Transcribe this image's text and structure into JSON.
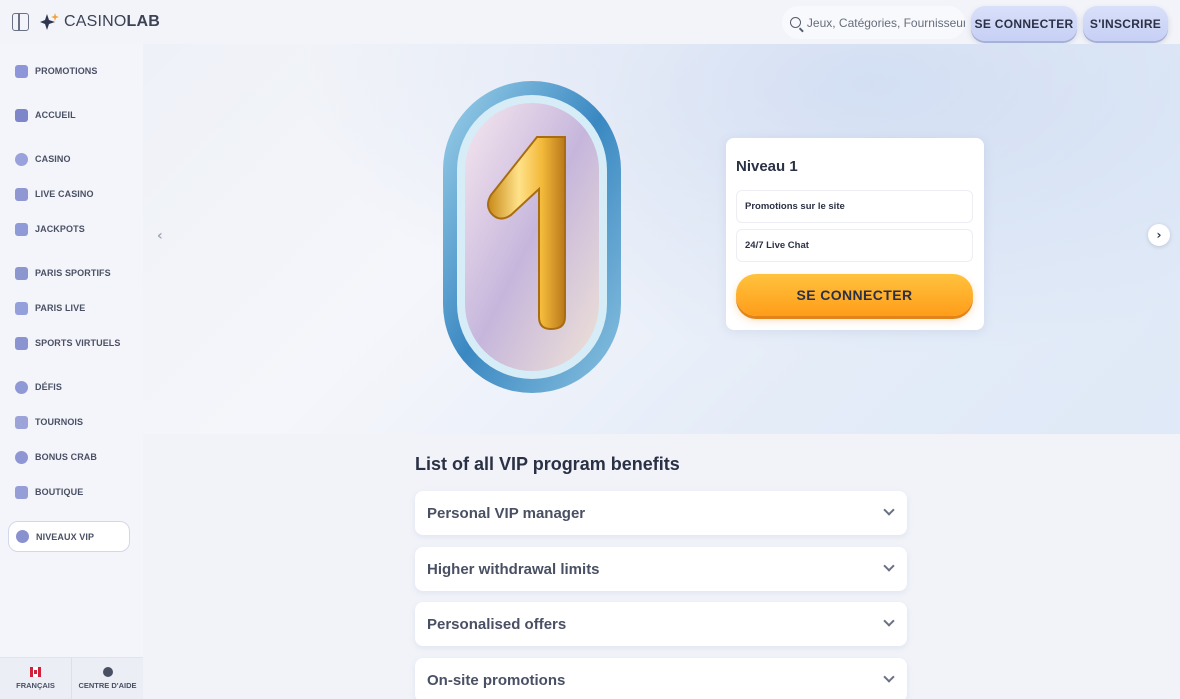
{
  "header": {
    "logo_prefix": "CASINO",
    "logo_suffix": "LAB",
    "search_placeholder": "Jeux, Catégories, Fournisseurs",
    "login_label": "SE CONNECTER",
    "signup_label": "S'INSCRIRE"
  },
  "sidebar": {
    "items": [
      {
        "label": "PROMOTIONS",
        "icon": "gift-icon",
        "color": "#8d96d8"
      },
      {
        "label": "ACCUEIL",
        "icon": "home-icon",
        "color": "#7c86c9"
      },
      {
        "label": "CASINO",
        "icon": "casino-chip-icon",
        "color": "#9aa2dc"
      },
      {
        "label": "LIVE CASINO",
        "icon": "live-casino-icon",
        "color": "#8f98d2"
      },
      {
        "label": "JACKPOTS",
        "icon": "jackpot-icon",
        "color": "#8e9bd6"
      },
      {
        "label": "PARIS SPORTIFS",
        "icon": "sports-betting-icon",
        "color": "#8c96cf"
      },
      {
        "label": "PARIS LIVE",
        "icon": "live-betting-icon",
        "color": "#94a0db"
      },
      {
        "label": "SPORTS VIRTUELS",
        "icon": "virtual-sports-icon",
        "color": "#8a94d0"
      },
      {
        "label": "DÉFIS",
        "icon": "challenge-icon",
        "color": "#8f99d6"
      },
      {
        "label": "TOURNOIS",
        "icon": "trophy-icon",
        "color": "#9ba3d8"
      },
      {
        "label": "BONUS CRAB",
        "icon": "bonus-crab-icon",
        "color": "#8e97d3"
      },
      {
        "label": "BOUTIQUE",
        "icon": "shop-icon",
        "color": "#959ed7"
      },
      {
        "label": "NIVEAUX VIP",
        "icon": "vip-icon",
        "color": "#8992cf"
      }
    ],
    "language_label": "FRANÇAIS",
    "help_label": "CENTRE D'AIDE"
  },
  "hero": {
    "badge_number": "1",
    "level_title": "Niveau 1",
    "perks": [
      "Promotions sur le site",
      "24/7 Live Chat"
    ],
    "cta_label": "SE CONNECTER"
  },
  "benefits": {
    "title": "List of all VIP program benefits",
    "items": [
      "Personal VIP manager",
      "Higher withdrawal limits",
      "Personalised offers",
      "On-site promotions"
    ]
  },
  "colors": {
    "accent_orange": "#ff9d1a",
    "pill_blue": "#c7d0f5",
    "text_dark": "#2b3145"
  }
}
